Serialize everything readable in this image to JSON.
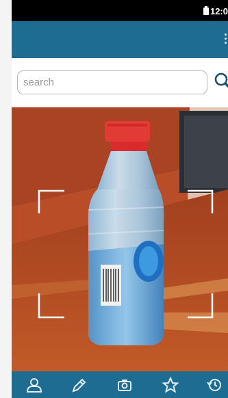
{
  "status_bar": {
    "time": "12:0"
  },
  "search": {
    "placeholder": "search",
    "value": ""
  },
  "icons": {
    "menu": "more-vert-icon",
    "search": "search-icon",
    "nav": [
      "person-icon",
      "pencil-icon",
      "camera-icon",
      "star-icon",
      "history-icon"
    ]
  },
  "colors": {
    "primary": "#1f6c93",
    "status_bar": "#000000",
    "nav_icon": "#e3eef4"
  }
}
